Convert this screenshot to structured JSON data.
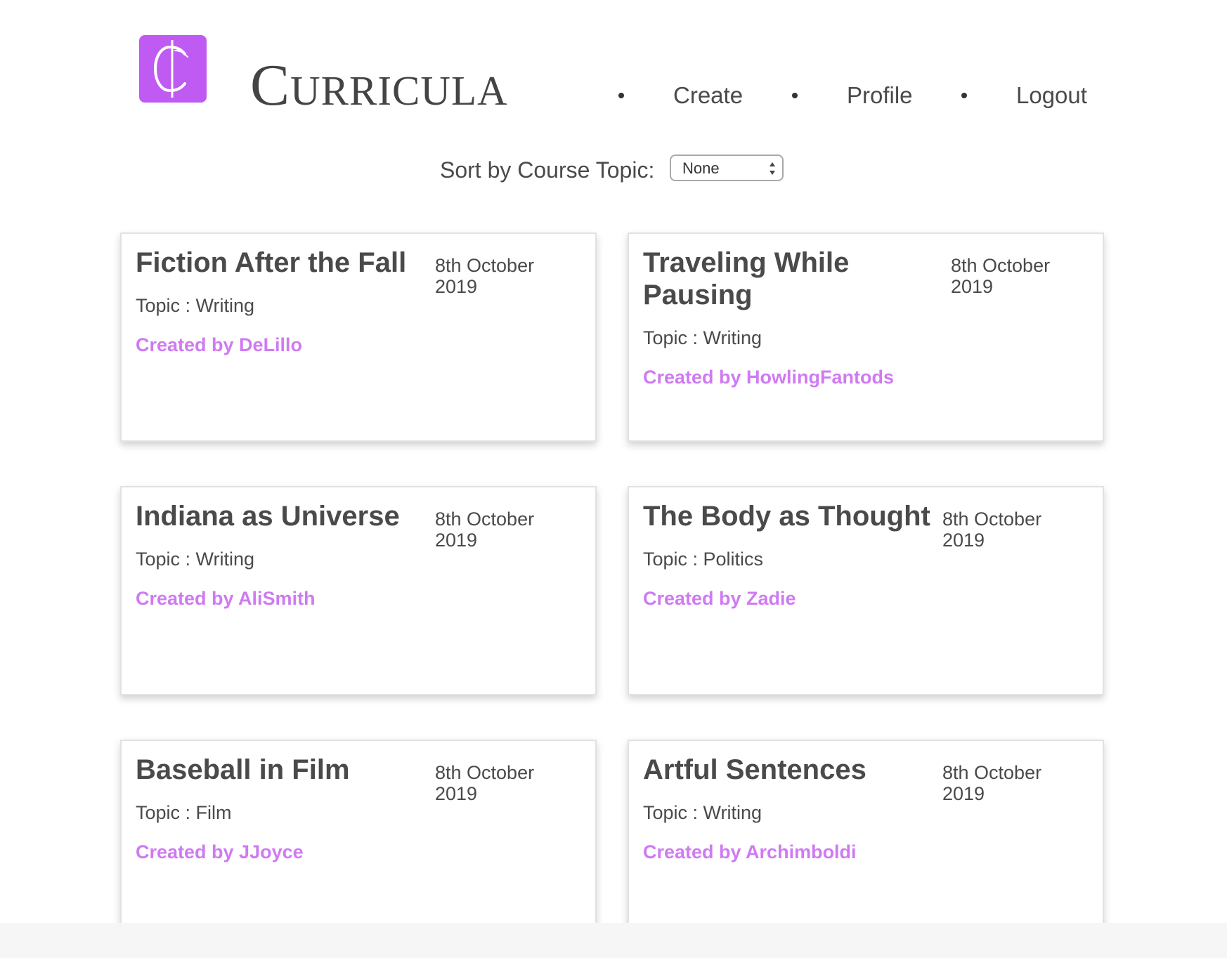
{
  "header": {
    "logo_glyph": "₵",
    "brand": "Curricula",
    "nav": [
      "Create",
      "Profile",
      "Logout"
    ]
  },
  "sort": {
    "label": "Sort by Course Topic:",
    "selected": "None"
  },
  "courses": [
    {
      "title": "Fiction After the Fall",
      "date": "8th October 2019",
      "topic": "Topic : Writing",
      "creator": "Created by DeLillo"
    },
    {
      "title": "Traveling While Pausing",
      "date": "8th October 2019",
      "topic": "Topic : Writing",
      "creator": "Created by HowlingFantods"
    },
    {
      "title": "Indiana as Universe",
      "date": "8th October 2019",
      "topic": "Topic : Writing",
      "creator": "Created by AliSmith"
    },
    {
      "title": "The Body as Thought",
      "date": "8th October 2019",
      "topic": "Topic : Politics",
      "creator": "Created by Zadie"
    },
    {
      "title": "Baseball in Film",
      "date": "8th October 2019",
      "topic": "Topic : Film",
      "creator": "Created by JJoyce"
    },
    {
      "title": "Artful Sentences",
      "date": "8th October 2019",
      "topic": "Topic : Writing",
      "creator": "Created by Archimboldi"
    }
  ],
  "colors": {
    "brand_purple": "#bf5af2",
    "creator_link": "#cf7af2",
    "text": "#4a4a4a"
  }
}
